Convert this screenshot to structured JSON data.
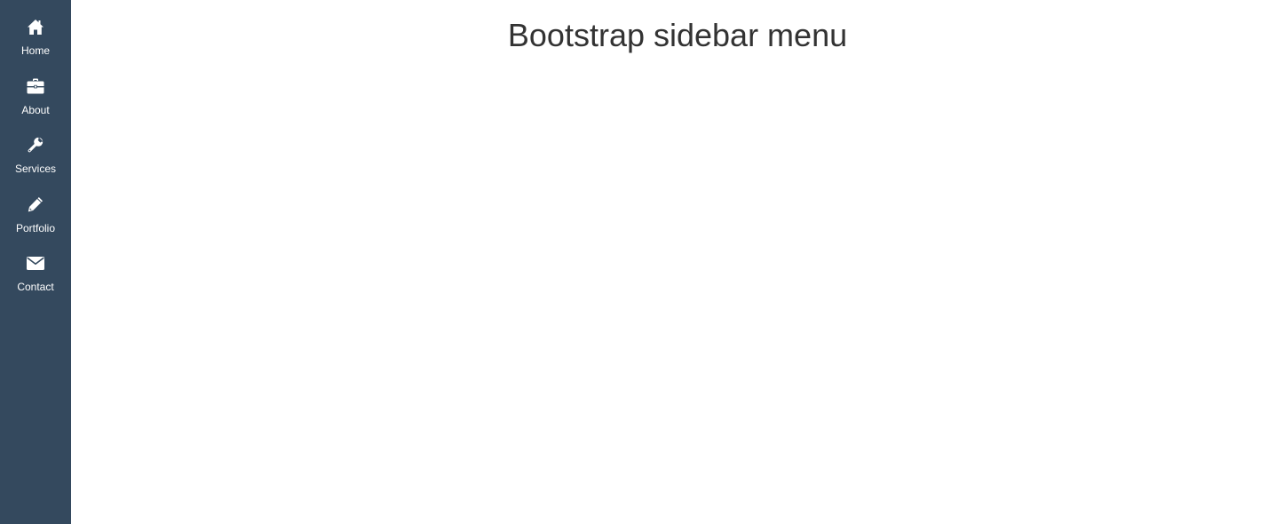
{
  "sidebar": {
    "background": "#34495e",
    "items": [
      {
        "label": "Home",
        "icon": "home-icon"
      },
      {
        "label": "About",
        "icon": "briefcase-icon"
      },
      {
        "label": "Services",
        "icon": "wrench-icon"
      },
      {
        "label": "Portfolio",
        "icon": "pencil-icon"
      },
      {
        "label": "Contact",
        "icon": "envelope-icon"
      }
    ]
  },
  "main": {
    "title": "Bootstrap sidebar menu"
  }
}
